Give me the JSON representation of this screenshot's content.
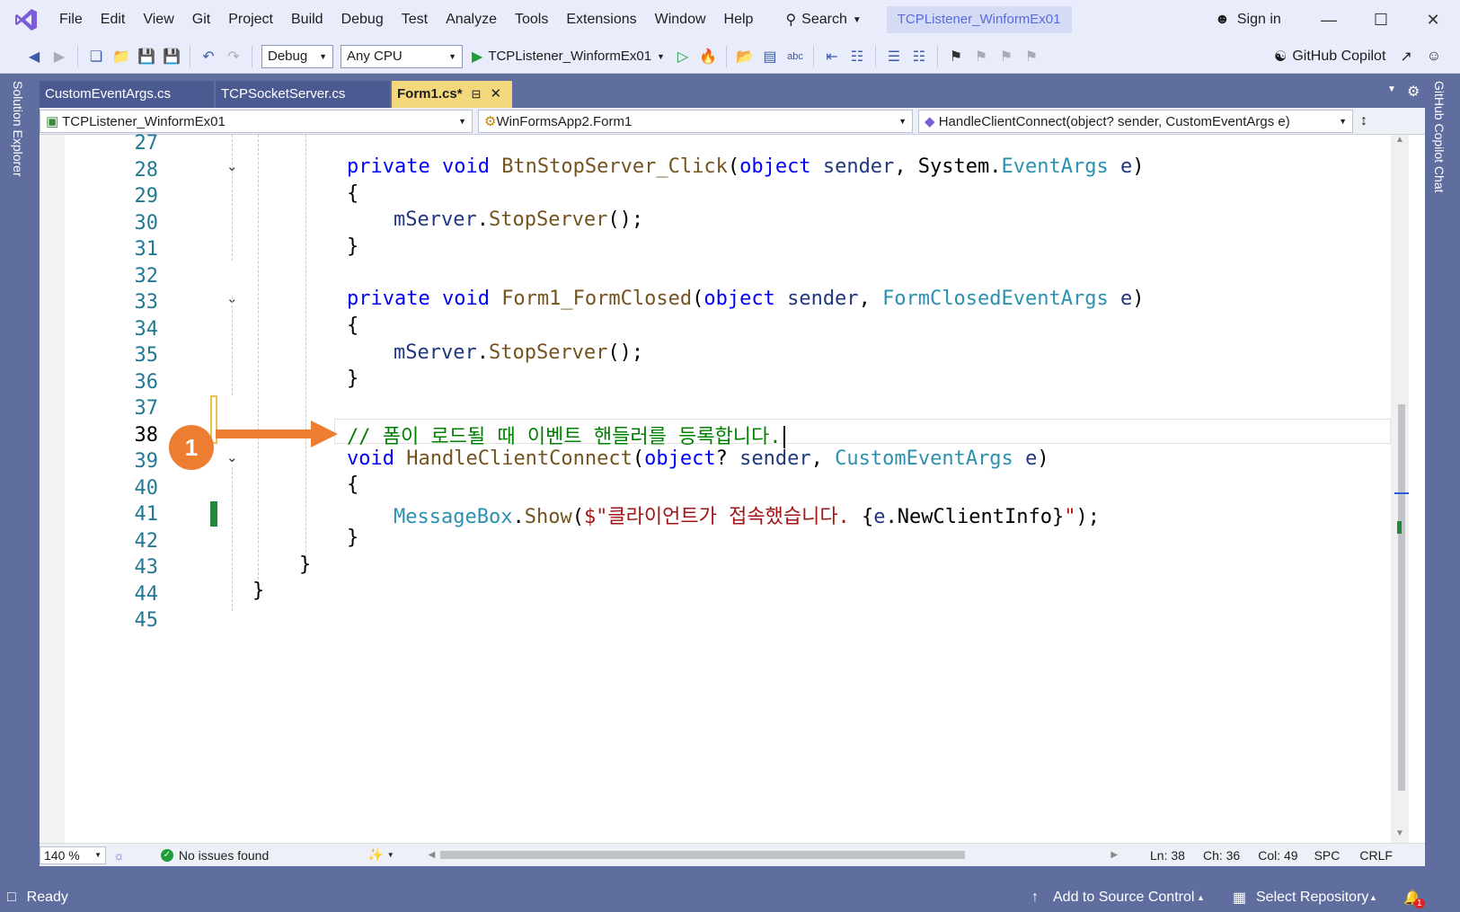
{
  "menu": [
    "File",
    "Edit",
    "View",
    "Git",
    "Project",
    "Build",
    "Debug",
    "Test",
    "Analyze",
    "Tools",
    "Extensions",
    "Window",
    "Help"
  ],
  "search": {
    "label": "Search"
  },
  "solution_name": "TCPListener_WinformEx01",
  "signin": "Sign in",
  "toolbar": {
    "config": "Debug",
    "platform": "Any CPU",
    "run_target": "TCPListener_WinformEx01",
    "copilot": "GitHub Copilot"
  },
  "side": {
    "left": "Solution Explorer",
    "right": "GitHub Copilot Chat"
  },
  "tabs": [
    {
      "label": "CustomEventArgs.cs"
    },
    {
      "label": "TCPSocketServer.cs"
    },
    {
      "label": "Form1.cs*"
    }
  ],
  "navbar": {
    "project": "TCPListener_WinformEx01",
    "class": "WinFormsApp2.Form1",
    "member": "HandleClientConnect(object? sender, CustomEventArgs e)"
  },
  "code": {
    "line_numbers": [
      "27",
      "28",
      "29",
      "30",
      "31",
      "32",
      "33",
      "34",
      "35",
      "36",
      "37",
      "38",
      "39",
      "40",
      "41",
      "42",
      "43",
      "44",
      "45"
    ],
    "current_line": "38"
  },
  "callout": {
    "number": "1"
  },
  "bottom": {
    "zoom": "140 %",
    "issues": "No issues found",
    "ln": "Ln: 38",
    "ch": "Ch: 36",
    "col": "Col: 49",
    "spc": "SPC",
    "crlf": "CRLF"
  },
  "status": {
    "ready": "Ready",
    "source_control": "Add to Source Control",
    "repository": "Select Repository",
    "notifications": "1"
  },
  "colors": {
    "accent": "#ed7d31",
    "tab_active": "#f4d87e",
    "frame": "#5f6d9f"
  }
}
